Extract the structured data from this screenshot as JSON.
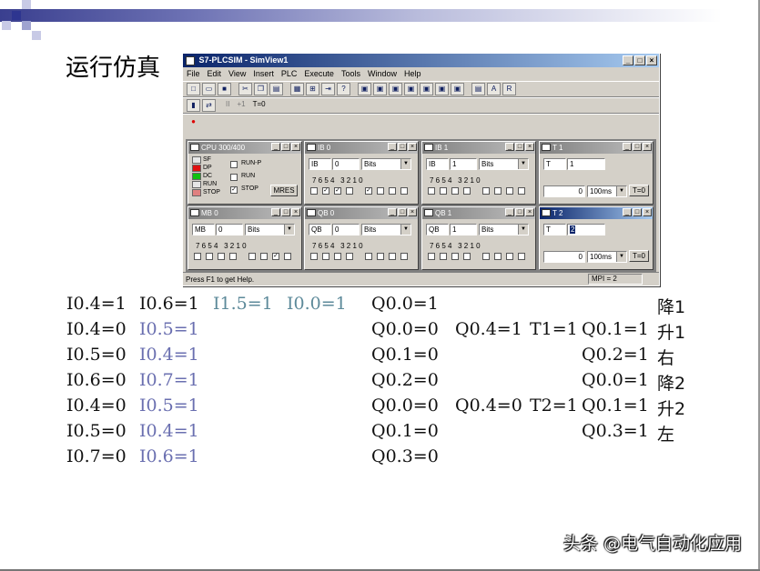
{
  "slide": {
    "title": "运行仿真",
    "watermark": "头条 @电气自动化应用",
    "colors": {
      "accent": "#3a3f8f",
      "highlight": "#6a6fb0",
      "teal": "#5d8a9a"
    }
  },
  "window": {
    "title": "S7-PLCSIM - SimView1",
    "menu": [
      "File",
      "Edit",
      "View",
      "Insert",
      "PLC",
      "Execute",
      "Tools",
      "Window",
      "Help"
    ],
    "toolbar_icons": [
      "new-icon",
      "open-icon",
      "save-icon",
      "cut-icon",
      "copy-icon",
      "paste-icon",
      "cascade-icon",
      "tile-icon",
      "insert-icon",
      "help-icon"
    ],
    "toolbar2": {
      "pause": "II",
      "step": "+1",
      "timer_reset": "T=0"
    },
    "status": "Press F1 to get Help.",
    "mpi": "MPI = 2",
    "cpu": {
      "title": "CPU 300/400",
      "leds": [
        "SF",
        "DP",
        "DC",
        "RUN",
        "STOP"
      ],
      "modes": [
        "RUN-P",
        "RUN",
        "STOP"
      ],
      "mres": "MRES"
    },
    "panels": [
      {
        "title": "IB   0",
        "type": "IB",
        "addr": "0",
        "fmt": "Bits",
        "bits": "7 6 5 4   3 2 1 0",
        "checked": [
          6,
          5,
          3
        ]
      },
      {
        "title": "IB   1",
        "type": "IB",
        "addr": "1",
        "fmt": "Bits",
        "bits": "7 6 5 4   3 2 1 0",
        "checked": []
      },
      {
        "title": "T   1",
        "type": "T",
        "addr": "1",
        "value": "0",
        "base": "100ms",
        "reset": "T=0"
      },
      {
        "title": "MB   0",
        "type": "MB",
        "addr": "0",
        "fmt": "Bits",
        "bits": "7 6 5 4   3 2 1 0",
        "checked": []
      },
      {
        "title": "QB   0",
        "type": "QB",
        "addr": "0",
        "fmt": "Bits",
        "bits": "7 6 5 4   3 2 1 0",
        "checked": []
      },
      {
        "title": "QB   1",
        "type": "QB",
        "addr": "1",
        "fmt": "Bits",
        "bits": "7 6 5 4   3 2 1 0",
        "checked": []
      },
      {
        "title": "T   2",
        "type": "T",
        "addr": "2",
        "value": "0",
        "base": "100ms",
        "reset": "T=0"
      }
    ],
    "qb0_checked": [
      1
    ]
  },
  "logic": {
    "rows": [
      {
        "a": "I0.4=1",
        "b": "I0.6=1",
        "c": "I1.5=1",
        "d": "I0.0=1",
        "e": "Q0.0=1",
        "f": "",
        "g": "",
        "h": "",
        "label": "降1"
      },
      {
        "a": "I0.4=0",
        "b": "I0.5=1",
        "c": "",
        "d": "",
        "e": "Q0.0=0",
        "f": "Q0.4=1",
        "g": "T1=1",
        "h": "Q0.1=1",
        "label": "升1"
      },
      {
        "a": "I0.5=0",
        "b": "I0.4=1",
        "c": "",
        "d": "",
        "e": "Q0.1=0",
        "f": "",
        "g": "",
        "h": "Q0.2=1",
        "label": "右"
      },
      {
        "a": "I0.6=0",
        "b": "I0.7=1",
        "c": "",
        "d": "",
        "e": "Q0.2=0",
        "f": "",
        "g": "",
        "h": "Q0.0=1",
        "label": "降2"
      },
      {
        "a": "I0.4=0",
        "b": "I0.5=1",
        "c": "",
        "d": "",
        "e": "Q0.0=0",
        "f": "Q0.4=0",
        "g": "T2=1",
        "h": "Q0.1=1",
        "label": "升2"
      },
      {
        "a": "I0.5=0",
        "b": "I0.4=1",
        "c": "",
        "d": "",
        "e": "Q0.1=0",
        "f": "",
        "g": "",
        "h": "Q0.3=1",
        "label": "左"
      },
      {
        "a": "I0.7=0",
        "b": "I0.6=1",
        "c": "",
        "d": "",
        "e": "Q0.3=0",
        "f": "",
        "g": "",
        "h": "",
        "label": ""
      }
    ]
  }
}
